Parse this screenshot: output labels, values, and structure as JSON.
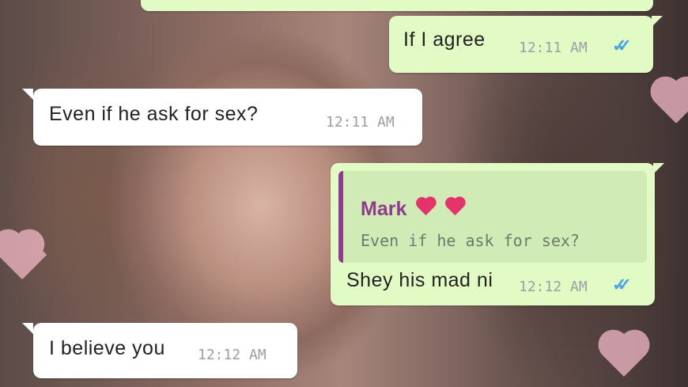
{
  "chat": {
    "messages": [
      {
        "direction": "out",
        "text": "If I agree",
        "time": "12:11 AM",
        "status_icon": "double-check-read-icon"
      },
      {
        "direction": "in",
        "text": "Even if he ask for sex?",
        "time": "12:11 AM"
      },
      {
        "direction": "out",
        "reply": {
          "author": "Mark",
          "author_emoji": "sparkling-heart-icon",
          "text": "Even if he ask for sex?"
        },
        "text": "Shey his mad ni",
        "time": "12:12 AM",
        "status_icon": "double-check-read-icon"
      },
      {
        "direction": "in",
        "text": "I believe you",
        "time": "12:12 AM"
      }
    ],
    "colors": {
      "outgoing_bubble": "#e2fbc5",
      "incoming_bubble": "#ffffff",
      "reply_accent": "#8e3c8c",
      "read_ticks": "#4aa4e6"
    }
  }
}
